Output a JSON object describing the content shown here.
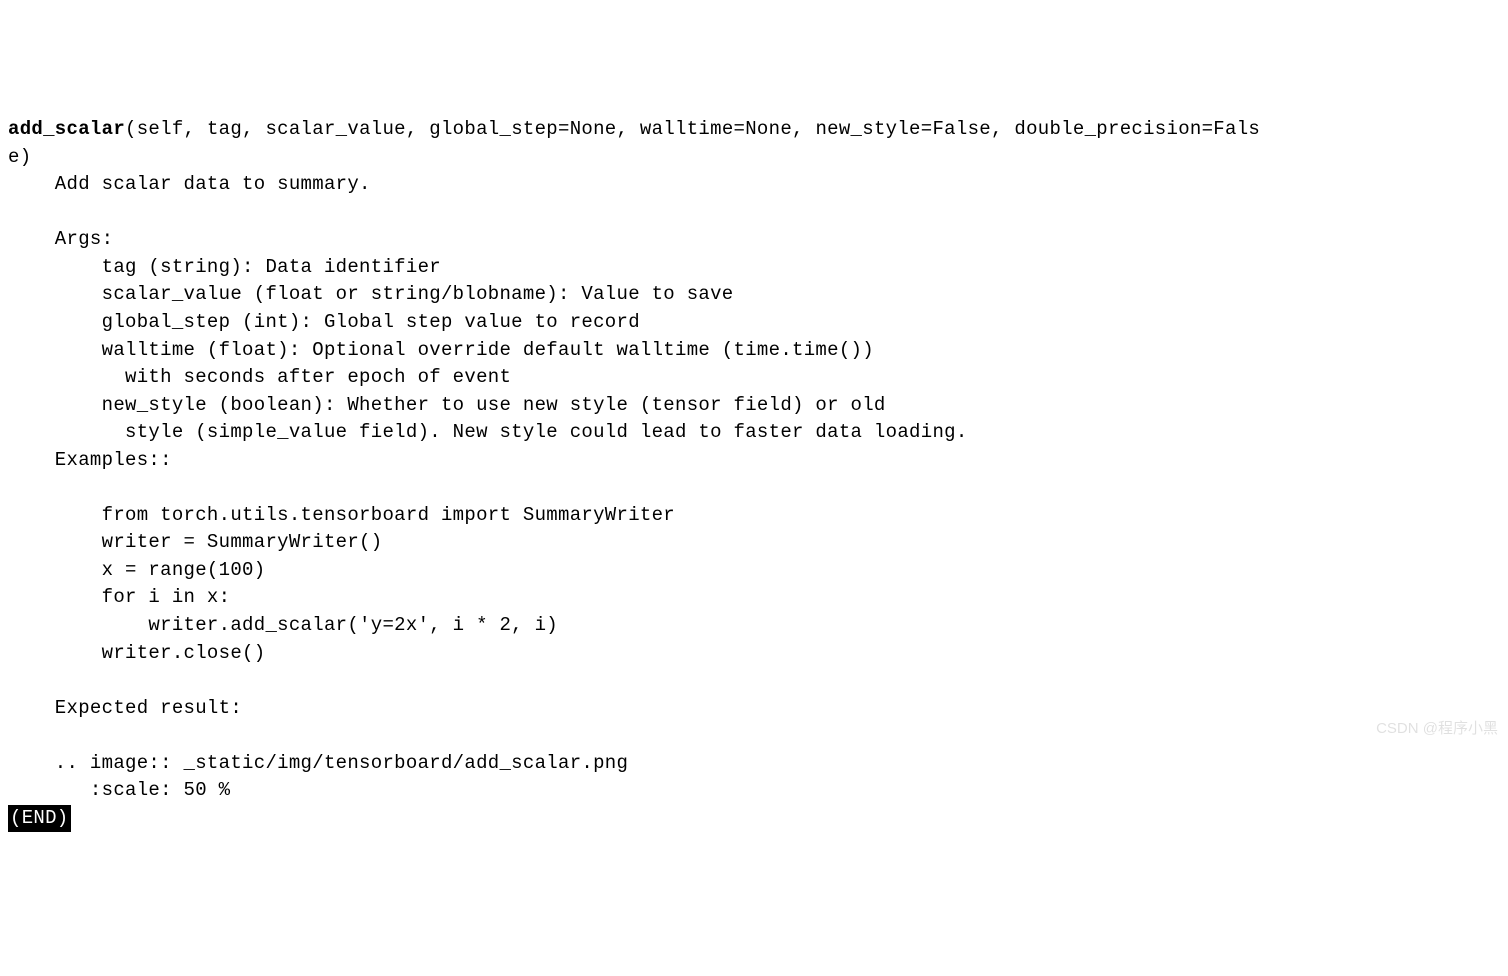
{
  "signature": {
    "func_name": "add_scalar",
    "params": "(self, tag, scalar_value, global_step=None, walltime=None, new_style=False, double_precision=Fals",
    "params_wrap": "e)"
  },
  "description": "    Add scalar data to summary.",
  "args": {
    "heading": "    Args:",
    "lines": [
      "        tag (string): Data identifier",
      "        scalar_value (float or string/blobname): Value to save",
      "        global_step (int): Global step value to record",
      "        walltime (float): Optional override default walltime (time.time())",
      "          with seconds after epoch of event",
      "        new_style (boolean): Whether to use new style (tensor field) or old",
      "          style (simple_value field). New style could lead to faster data loading."
    ]
  },
  "examples": {
    "heading": "    Examples::",
    "code": [
      "        from torch.utils.tensorboard import SummaryWriter",
      "        writer = SummaryWriter()",
      "        x = range(100)",
      "        for i in x:",
      "            writer.add_scalar('y=2x', i * 2, i)",
      "        writer.close()"
    ]
  },
  "expected_result": "    Expected result:",
  "image_directive": [
    "    .. image:: _static/img/tensorboard/add_scalar.png",
    "       :scale: 50 %"
  ],
  "end_marker": "(END)",
  "watermark": "CSDN @程序小黑"
}
